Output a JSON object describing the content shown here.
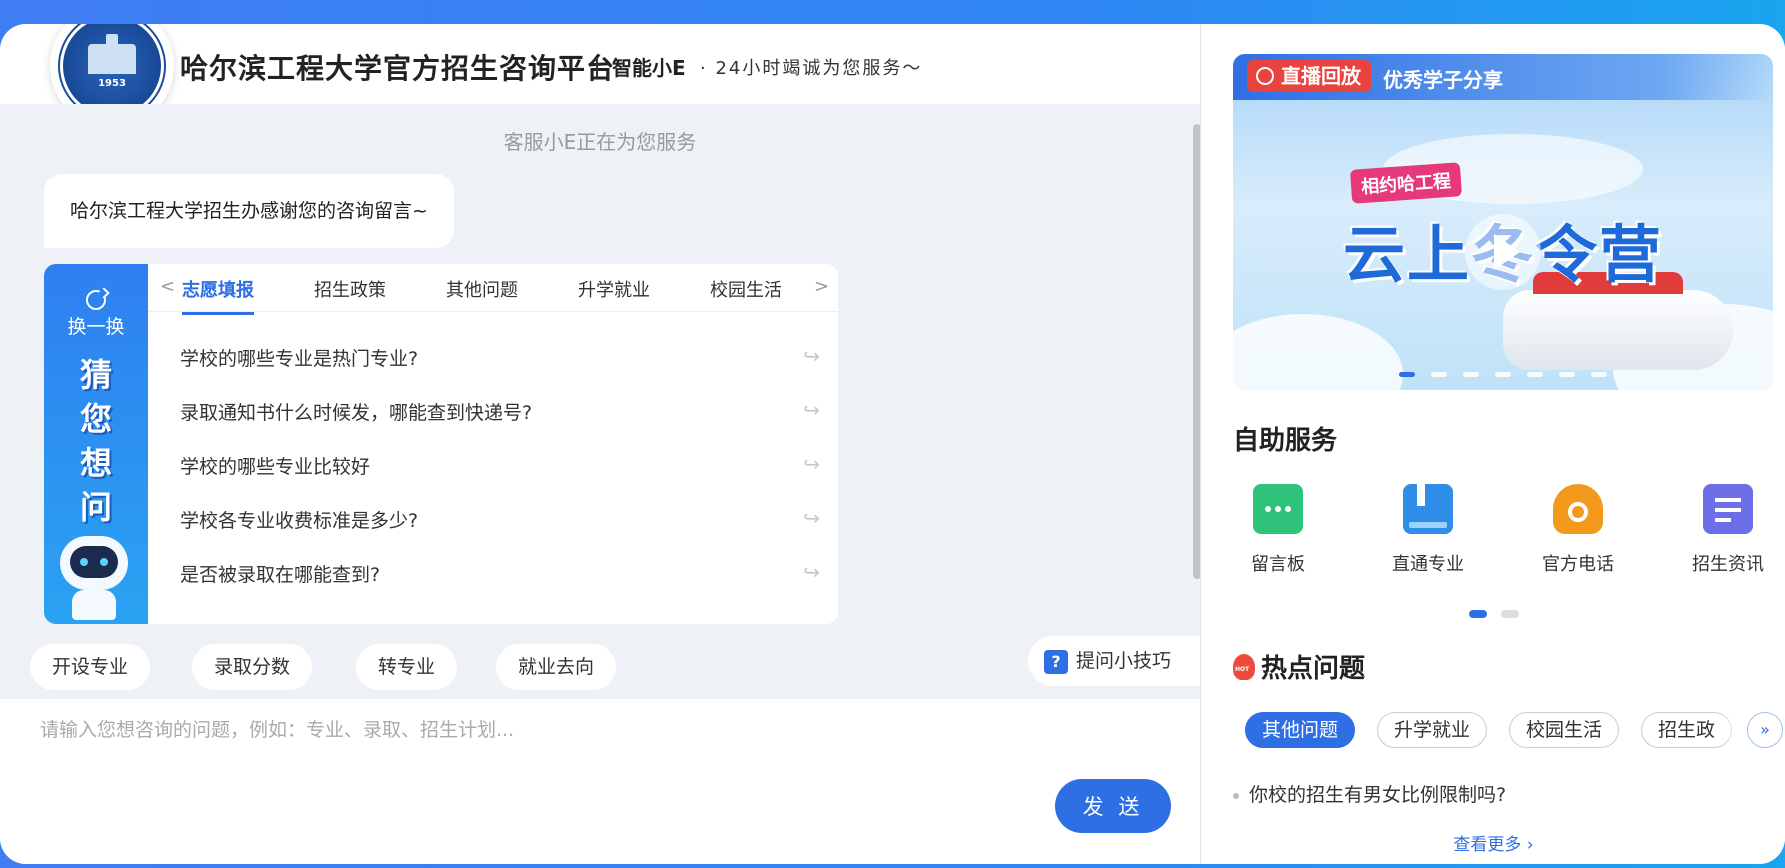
{
  "header": {
    "logo_year": "1953",
    "title": "哈尔滨工程大学官方招生咨询平台",
    "brand": "智能小E",
    "tagline": "· 24小时竭诚为您服务～"
  },
  "chat": {
    "status": "客服小E正在为您服务",
    "welcome": "哈尔滨工程大学招生办感谢您的咨询留言~",
    "guess": {
      "refresh_label": "换一换",
      "side_chars": [
        "猜",
        "您",
        "想",
        "问"
      ],
      "tabs": [
        "志愿填报",
        "招生政策",
        "其他问题",
        "升学就业",
        "校园生活"
      ],
      "active_tab": "志愿填报",
      "questions": [
        "学校的哪些专业是热门专业?",
        "录取通知书什么时候发，哪能查到快递号?",
        "学校的哪些专业比较好",
        "学校各专业收费标准是多少?",
        "是否被录取在哪能查到?"
      ]
    },
    "chips": [
      "开设专业",
      "录取分数",
      "转专业",
      "就业去向"
    ],
    "tips_label": "提问小技巧"
  },
  "input": {
    "placeholder": "请输入您想咨询的问题，例如：专业、录取、招生计划...",
    "value": "",
    "send_label": "发 送"
  },
  "right": {
    "banner": {
      "badge": "直播回放",
      "title": "优秀学子分享",
      "subtitle": "相约哈工程",
      "main_text": "云上冬令营"
    },
    "self_service": {
      "title": "自助服务",
      "items": [
        {
          "label": "留言板",
          "icon": "message-board-icon",
          "color": "#2fc27a"
        },
        {
          "label": "直通专业",
          "icon": "book-icon",
          "color": "#2f8ee8"
        },
        {
          "label": "官方电话",
          "icon": "phone-icon",
          "color": "#f39a1e"
        },
        {
          "label": "招生资讯",
          "icon": "document-icon",
          "color": "#6e6ee8"
        }
      ]
    },
    "hot": {
      "title": "热点问题",
      "tabs": [
        "其他问题",
        "升学就业",
        "校园生活",
        "招生政"
      ],
      "active_tab": "其他问题",
      "questions": [
        "你校的招生有男女比例限制吗?"
      ],
      "more_label": "查看更多"
    }
  },
  "colors": {
    "accent": "#2f6fe4",
    "live_red": "#e8433f",
    "hot_red": "#ec4b3c"
  }
}
